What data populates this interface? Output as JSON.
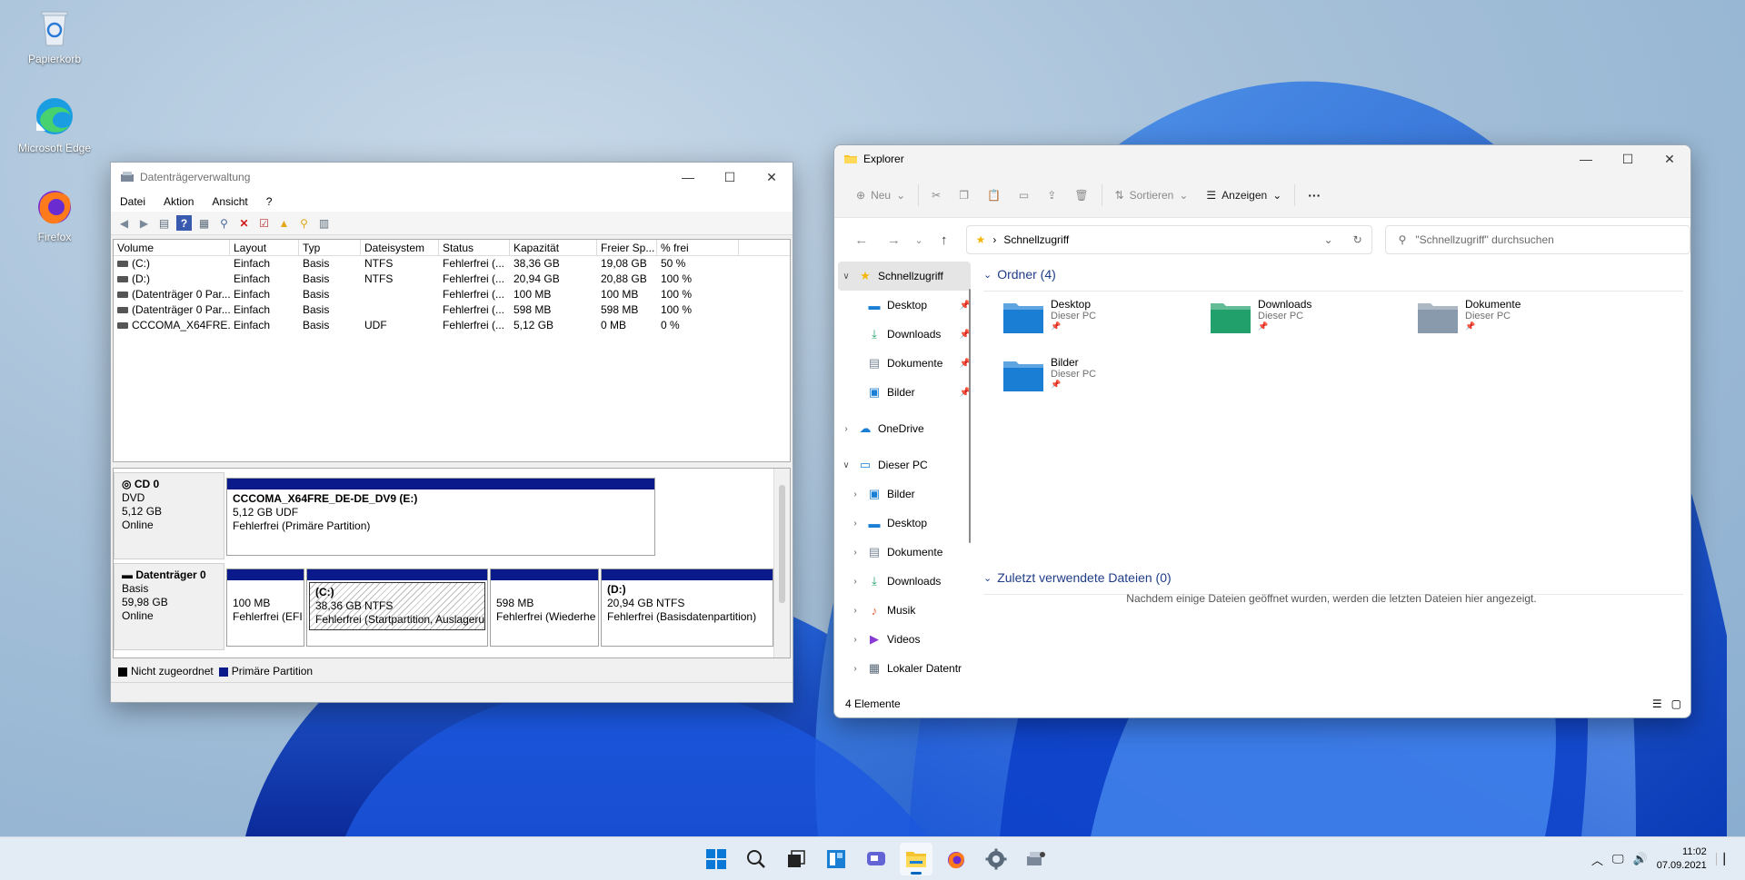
{
  "desktop": {
    "icons": [
      {
        "label": "Papierkorb"
      },
      {
        "label": "Microsoft Edge"
      },
      {
        "label": "Firefox"
      }
    ]
  },
  "disk_mgmt": {
    "title": "Datenträgerverwaltung",
    "menu": [
      "Datei",
      "Aktion",
      "Ansicht",
      "?"
    ],
    "columns": [
      "Volume",
      "Layout",
      "Typ",
      "Dateisystem",
      "Status",
      "Kapazität",
      "Freier Sp...",
      "% frei"
    ],
    "rows": [
      [
        "(C:)",
        "Einfach",
        "Basis",
        "NTFS",
        "Fehlerfrei (...",
        "38,36 GB",
        "19,08 GB",
        "50 %"
      ],
      [
        "(D:)",
        "Einfach",
        "Basis",
        "NTFS",
        "Fehlerfrei (...",
        "20,94 GB",
        "20,88 GB",
        "100 %"
      ],
      [
        "(Datenträger 0 Par...",
        "Einfach",
        "Basis",
        "",
        "Fehlerfrei (...",
        "100 MB",
        "100 MB",
        "100 %"
      ],
      [
        "(Datenträger 0 Par...",
        "Einfach",
        "Basis",
        "",
        "Fehlerfrei (...",
        "598 MB",
        "598 MB",
        "100 %"
      ],
      [
        "CCCOMA_X64FRE...",
        "Einfach",
        "Basis",
        "UDF",
        "Fehlerfrei (...",
        "5,12 GB",
        "0 MB",
        "0 %"
      ]
    ],
    "disks": [
      {
        "name": "CD 0",
        "lines": [
          "DVD",
          "5,12 GB",
          "Online"
        ],
        "partitions": [
          {
            "title": "CCCOMA_X64FRE_DE-DE_DV9  (E:)",
            "size": "5,12 GB UDF",
            "status": "Fehlerfrei (Primäre Partition)"
          }
        ]
      },
      {
        "name": "Datenträger 0",
        "lines": [
          "Basis",
          "59,98 GB",
          "Online"
        ],
        "partitions": [
          {
            "title": "",
            "size": "100 MB",
            "status": "Fehlerfrei (EFI"
          },
          {
            "title": "(C:)",
            "size": "38,36 GB NTFS",
            "status": "Fehlerfrei (Startpartition, Auslagerui"
          },
          {
            "title": "",
            "size": "598 MB",
            "status": "Fehlerfrei (Wiederhe"
          },
          {
            "title": "(D:)",
            "size": "20,94 GB NTFS",
            "status": "Fehlerfrei (Basisdatenpartition)"
          }
        ]
      }
    ],
    "legend": [
      {
        "label": "Nicht zugeordnet",
        "color": "#000000"
      },
      {
        "label": "Primäre Partition",
        "color": "#0a1a8a"
      }
    ]
  },
  "explorer": {
    "title": "Explorer",
    "cmd": {
      "new": "Neu",
      "sort": "Sortieren",
      "view": "Anzeigen",
      "more": "···"
    },
    "address": "Schnellzugriff",
    "search_placeholder": "\"Schnellzugriff\" durchsuchen",
    "nav": [
      {
        "label": "Schnellzugriff",
        "icon": "star-icon",
        "chev": "∨",
        "indent": 0,
        "sel": true
      },
      {
        "label": "Desktop",
        "icon": "desktop-icon",
        "chev": "",
        "indent": 1,
        "pin": true
      },
      {
        "label": "Downloads",
        "icon": "download-icon",
        "chev": "",
        "indent": 1,
        "pin": true
      },
      {
        "label": "Dokumente",
        "icon": "document-icon",
        "chev": "",
        "indent": 1,
        "pin": true
      },
      {
        "label": "Bilder",
        "icon": "picture-icon",
        "chev": "",
        "indent": 1,
        "pin": true
      },
      {
        "label": "OneDrive",
        "icon": "cloud-icon",
        "chev": "›",
        "indent": 0
      },
      {
        "label": "Dieser PC",
        "icon": "pc-icon",
        "chev": "∨",
        "indent": 0
      },
      {
        "label": "Bilder",
        "icon": "picture-icon",
        "chev": "›",
        "indent": 1
      },
      {
        "label": "Desktop",
        "icon": "desktop-icon",
        "chev": "›",
        "indent": 1
      },
      {
        "label": "Dokumente",
        "icon": "document-icon",
        "chev": "›",
        "indent": 1
      },
      {
        "label": "Downloads",
        "icon": "download-icon",
        "chev": "›",
        "indent": 1
      },
      {
        "label": "Musik",
        "icon": "music-icon",
        "chev": "›",
        "indent": 1
      },
      {
        "label": "Videos",
        "icon": "video-icon",
        "chev": "›",
        "indent": 1
      },
      {
        "label": "Lokaler Datentr",
        "icon": "drive-icon",
        "chev": "›",
        "indent": 1
      }
    ],
    "folders_header": "Ordner (4)",
    "folders": [
      {
        "name": "Desktop",
        "sub": "Dieser PC",
        "icon": "desktop-folder-icon",
        "color": "#1a7fd4"
      },
      {
        "name": "Downloads",
        "sub": "Dieser PC",
        "icon": "downloads-folder-icon",
        "color": "#22a06b"
      },
      {
        "name": "Dokumente",
        "sub": "Dieser PC",
        "icon": "documents-folder-icon",
        "color": "#8a9aad"
      },
      {
        "name": "Bilder",
        "sub": "Dieser PC",
        "icon": "pictures-folder-icon",
        "color": "#1a7fd4"
      }
    ],
    "recent_header": "Zuletzt verwendete Dateien (0)",
    "recent_empty": "Nachdem einige Dateien geöffnet wurden, werden die letzten Dateien hier angezeigt.",
    "status": "4 Elemente"
  },
  "taskbar": {
    "time": "11:02",
    "date": "07.09.2021",
    "accent": "#0067c0"
  }
}
